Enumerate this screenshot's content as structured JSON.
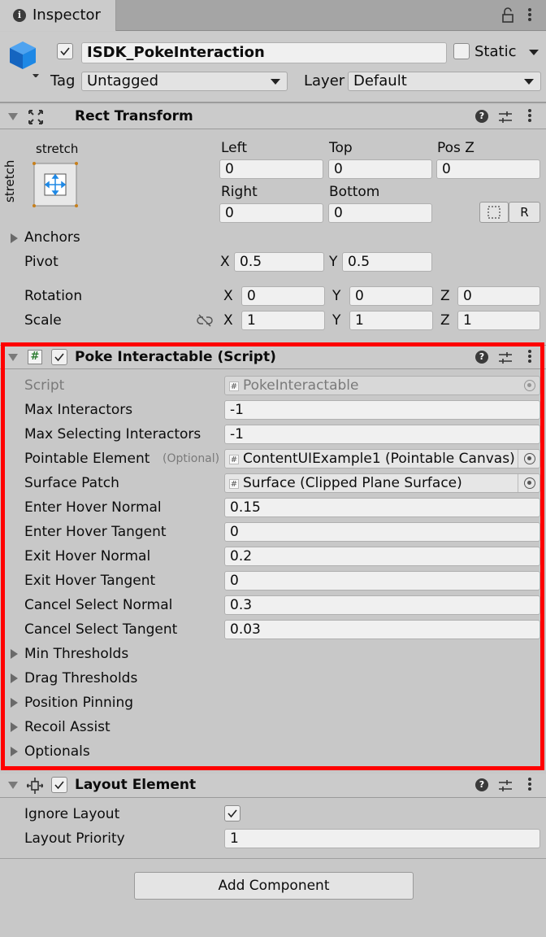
{
  "tab": {
    "title": "Inspector",
    "info_glyph": "i"
  },
  "object": {
    "name": "ISDK_PokeInteraction",
    "active": true,
    "static_label": "Static",
    "static_checked": false,
    "tag_label": "Tag",
    "tag_value": "Untagged",
    "layer_label": "Layer",
    "layer_value": "Default"
  },
  "rect_transform": {
    "title": "Rect Transform",
    "anchor_horizontal": "stretch",
    "anchor_vertical": "stretch",
    "left_label": "Left",
    "left": "0",
    "top_label": "Top",
    "top": "0",
    "posz_label": "Pos Z",
    "posz": "0",
    "right_label": "Right",
    "right": "0",
    "bottom_label": "Bottom",
    "bottom": "0",
    "r_button": "R",
    "anchors_label": "Anchors",
    "pivot_label": "Pivot",
    "pivot_x": "0.5",
    "pivot_y": "0.5",
    "rotation_label": "Rotation",
    "rotation_x": "0",
    "rotation_y": "0",
    "rotation_z": "0",
    "scale_label": "Scale",
    "scale_x": "1",
    "scale_y": "1",
    "scale_z": "1",
    "axis_x": "X",
    "axis_y": "Y",
    "axis_z": "Z"
  },
  "poke": {
    "title": "Poke Interactable (Script)",
    "enabled": true,
    "script_label": "Script",
    "script_value": "PokeInteractable",
    "max_interactors_label": "Max Interactors",
    "max_interactors": "-1",
    "max_selecting_label": "Max Selecting Interactors",
    "max_selecting": "-1",
    "pointable_label": "Pointable Element",
    "optional_tag": "(Optional)",
    "pointable_value": "ContentUIExample1 (Pointable Canvas)",
    "surface_label": "Surface Patch",
    "surface_value": "Surface (Clipped Plane Surface)",
    "enter_hover_normal_label": "Enter Hover Normal",
    "enter_hover_normal": "0.15",
    "enter_hover_tangent_label": "Enter Hover Tangent",
    "enter_hover_tangent": "0",
    "exit_hover_normal_label": "Exit Hover Normal",
    "exit_hover_normal": "0.2",
    "exit_hover_tangent_label": "Exit Hover Tangent",
    "exit_hover_tangent": "0",
    "cancel_select_normal_label": "Cancel Select Normal",
    "cancel_select_normal": "0.3",
    "cancel_select_tangent_label": "Cancel Select Tangent",
    "cancel_select_tangent": "0.03",
    "foldouts": [
      "Min Thresholds",
      "Drag Thresholds",
      "Position Pinning",
      "Recoil Assist",
      "Optionals"
    ]
  },
  "layout_element": {
    "title": "Layout Element",
    "enabled": true,
    "ignore_layout_label": "Ignore Layout",
    "ignore_layout": true,
    "layout_priority_label": "Layout Priority",
    "layout_priority": "1"
  },
  "add_component_label": "Add Component",
  "colors": {
    "highlight": "#ff0000",
    "panel": "#c8c8c8",
    "accent_blue": "#1e88e5"
  }
}
